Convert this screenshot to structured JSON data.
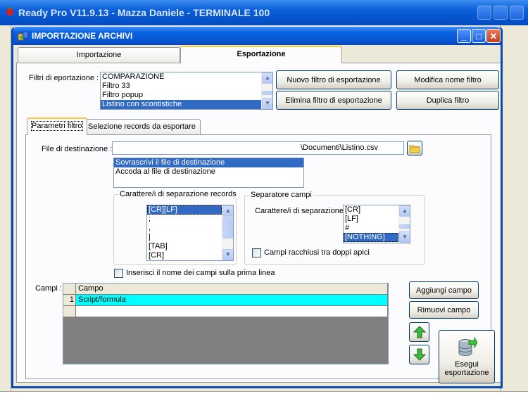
{
  "parent_window": {
    "title": "Ready Pro V11.9.13 - Mazza Daniele - TERMINALE 100"
  },
  "dialog": {
    "title": "IMPORTAZIONE ARCHIVI",
    "tabs": [
      "Importazione",
      "Esportazione"
    ],
    "active_tab": "Esportazione"
  },
  "export": {
    "filters_label": "Filtri di eportazione :",
    "filters": [
      "COMPARAZIONE",
      "Filtro 33",
      "Filtro popup",
      "Listino con scontistiche"
    ],
    "selected_filter": "Listino con scontistiche",
    "buttons": {
      "new_filter": "Nuovo filtro di esportazione",
      "rename_filter": "Modifica nome filtro",
      "delete_filter": "Elimina filtro di esportazione",
      "duplicate_filter": "Duplica filtro"
    },
    "subtabs": [
      "Parametri filtro",
      "Selezione records da esportare"
    ],
    "active_subtab": "Parametri filtro",
    "dest_file_label": "File di destinazione :",
    "dest_file_value": "\\Documenti\\Listino.csv",
    "write_modes": [
      "Sovrascrivi il file di destinazione",
      "Accoda al file di destinazione"
    ],
    "selected_write_mode": "Sovrascrivi il file di destinazione",
    "record_sep_group": "Carattere/i di separazione records",
    "record_separators": [
      "[CR][LF]",
      ";",
      ",",
      "|",
      "[TAB]",
      "[CR]"
    ],
    "selected_record_sep": "[CR][LF]",
    "field_sep_group": "Separatore campi",
    "field_sep_label": "Carattere/i di separazione",
    "field_separators": [
      "[CR]",
      "[LF]",
      "#",
      "[NOTHING]"
    ],
    "selected_field_sep": "[NOTHING]",
    "quote_fields_label": "Campi racchiusi tra doppi apici",
    "quote_fields_checked": false,
    "header_line_label": "Inserisci il nome dei campi sulla prima linea",
    "header_line_checked": false,
    "fields_label": "Campi :",
    "fields_grid": {
      "header": "Campo",
      "rows": [
        {
          "num": "1",
          "campo": "Script/formula"
        }
      ]
    },
    "add_field_button": "Aggiungi campo",
    "remove_field_button": "Rimuovi campo",
    "run_export_button": [
      "Esegui",
      "esportazione"
    ],
    "colors": {
      "selection": "#316ac5",
      "grid_highlight": "#00ffff"
    }
  }
}
